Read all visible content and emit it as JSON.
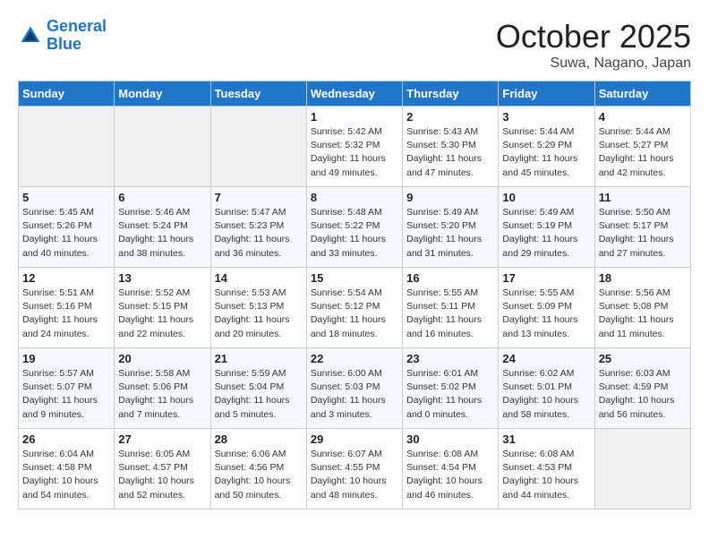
{
  "header": {
    "logo_line1": "General",
    "logo_line2": "Blue",
    "month": "October 2025",
    "location": "Suwa, Nagano, Japan"
  },
  "days_of_week": [
    "Sunday",
    "Monday",
    "Tuesday",
    "Wednesday",
    "Thursday",
    "Friday",
    "Saturday"
  ],
  "weeks": [
    [
      {
        "day": "",
        "info": ""
      },
      {
        "day": "",
        "info": ""
      },
      {
        "day": "",
        "info": ""
      },
      {
        "day": "1",
        "info": "Sunrise: 5:42 AM\nSunset: 5:32 PM\nDaylight: 11 hours\nand 49 minutes."
      },
      {
        "day": "2",
        "info": "Sunrise: 5:43 AM\nSunset: 5:30 PM\nDaylight: 11 hours\nand 47 minutes."
      },
      {
        "day": "3",
        "info": "Sunrise: 5:44 AM\nSunset: 5:29 PM\nDaylight: 11 hours\nand 45 minutes."
      },
      {
        "day": "4",
        "info": "Sunrise: 5:44 AM\nSunset: 5:27 PM\nDaylight: 11 hours\nand 42 minutes."
      }
    ],
    [
      {
        "day": "5",
        "info": "Sunrise: 5:45 AM\nSunset: 5:26 PM\nDaylight: 11 hours\nand 40 minutes."
      },
      {
        "day": "6",
        "info": "Sunrise: 5:46 AM\nSunset: 5:24 PM\nDaylight: 11 hours\nand 38 minutes."
      },
      {
        "day": "7",
        "info": "Sunrise: 5:47 AM\nSunset: 5:23 PM\nDaylight: 11 hours\nand 36 minutes."
      },
      {
        "day": "8",
        "info": "Sunrise: 5:48 AM\nSunset: 5:22 PM\nDaylight: 11 hours\nand 33 minutes."
      },
      {
        "day": "9",
        "info": "Sunrise: 5:49 AM\nSunset: 5:20 PM\nDaylight: 11 hours\nand 31 minutes."
      },
      {
        "day": "10",
        "info": "Sunrise: 5:49 AM\nSunset: 5:19 PM\nDaylight: 11 hours\nand 29 minutes."
      },
      {
        "day": "11",
        "info": "Sunrise: 5:50 AM\nSunset: 5:17 PM\nDaylight: 11 hours\nand 27 minutes."
      }
    ],
    [
      {
        "day": "12",
        "info": "Sunrise: 5:51 AM\nSunset: 5:16 PM\nDaylight: 11 hours\nand 24 minutes."
      },
      {
        "day": "13",
        "info": "Sunrise: 5:52 AM\nSunset: 5:15 PM\nDaylight: 11 hours\nand 22 minutes."
      },
      {
        "day": "14",
        "info": "Sunrise: 5:53 AM\nSunset: 5:13 PM\nDaylight: 11 hours\nand 20 minutes."
      },
      {
        "day": "15",
        "info": "Sunrise: 5:54 AM\nSunset: 5:12 PM\nDaylight: 11 hours\nand 18 minutes."
      },
      {
        "day": "16",
        "info": "Sunrise: 5:55 AM\nSunset: 5:11 PM\nDaylight: 11 hours\nand 16 minutes."
      },
      {
        "day": "17",
        "info": "Sunrise: 5:55 AM\nSunset: 5:09 PM\nDaylight: 11 hours\nand 13 minutes."
      },
      {
        "day": "18",
        "info": "Sunrise: 5:56 AM\nSunset: 5:08 PM\nDaylight: 11 hours\nand 11 minutes."
      }
    ],
    [
      {
        "day": "19",
        "info": "Sunrise: 5:57 AM\nSunset: 5:07 PM\nDaylight: 11 hours\nand 9 minutes."
      },
      {
        "day": "20",
        "info": "Sunrise: 5:58 AM\nSunset: 5:06 PM\nDaylight: 11 hours\nand 7 minutes."
      },
      {
        "day": "21",
        "info": "Sunrise: 5:59 AM\nSunset: 5:04 PM\nDaylight: 11 hours\nand 5 minutes."
      },
      {
        "day": "22",
        "info": "Sunrise: 6:00 AM\nSunset: 5:03 PM\nDaylight: 11 hours\nand 3 minutes."
      },
      {
        "day": "23",
        "info": "Sunrise: 6:01 AM\nSunset: 5:02 PM\nDaylight: 11 hours\nand 0 minutes."
      },
      {
        "day": "24",
        "info": "Sunrise: 6:02 AM\nSunset: 5:01 PM\nDaylight: 10 hours\nand 58 minutes."
      },
      {
        "day": "25",
        "info": "Sunrise: 6:03 AM\nSunset: 4:59 PM\nDaylight: 10 hours\nand 56 minutes."
      }
    ],
    [
      {
        "day": "26",
        "info": "Sunrise: 6:04 AM\nSunset: 4:58 PM\nDaylight: 10 hours\nand 54 minutes."
      },
      {
        "day": "27",
        "info": "Sunrise: 6:05 AM\nSunset: 4:57 PM\nDaylight: 10 hours\nand 52 minutes."
      },
      {
        "day": "28",
        "info": "Sunrise: 6:06 AM\nSunset: 4:56 PM\nDaylight: 10 hours\nand 50 minutes."
      },
      {
        "day": "29",
        "info": "Sunrise: 6:07 AM\nSunset: 4:55 PM\nDaylight: 10 hours\nand 48 minutes."
      },
      {
        "day": "30",
        "info": "Sunrise: 6:08 AM\nSunset: 4:54 PM\nDaylight: 10 hours\nand 46 minutes."
      },
      {
        "day": "31",
        "info": "Sunrise: 6:08 AM\nSunset: 4:53 PM\nDaylight: 10 hours\nand 44 minutes."
      },
      {
        "day": "",
        "info": ""
      }
    ]
  ]
}
